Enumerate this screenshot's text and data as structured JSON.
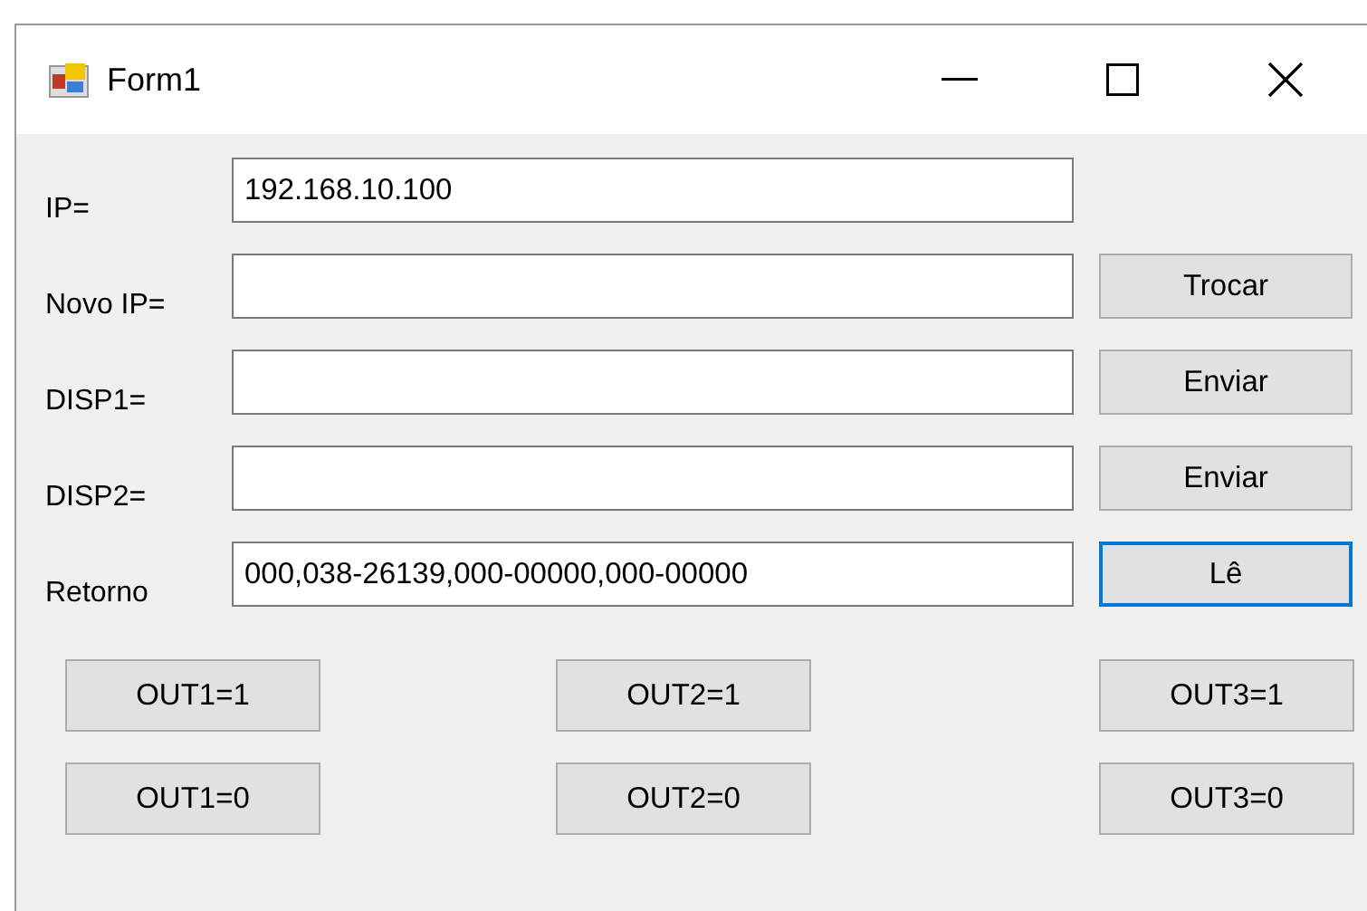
{
  "window": {
    "title": "Form1"
  },
  "rows": [
    {
      "label": "IP=",
      "value": "192.168.10.100"
    },
    {
      "label": "Novo IP=",
      "value": "",
      "button": {
        "label": "Trocar",
        "focused": false
      }
    },
    {
      "label": "DISP1=",
      "value": "",
      "button": {
        "label": "Enviar",
        "focused": false
      }
    },
    {
      "label": "DISP2=",
      "value": "",
      "button": {
        "label": "Enviar",
        "focused": false
      }
    },
    {
      "label": "Retorno",
      "value": "000,038-26139,000-00000,000-00000",
      "button": {
        "label": "Lê",
        "focused": true
      }
    }
  ],
  "outputs": [
    [
      "OUT1=1",
      "OUT2=1",
      "OUT3=1"
    ],
    [
      "OUT1=0",
      "OUT2=0",
      "OUT3=0"
    ]
  ]
}
